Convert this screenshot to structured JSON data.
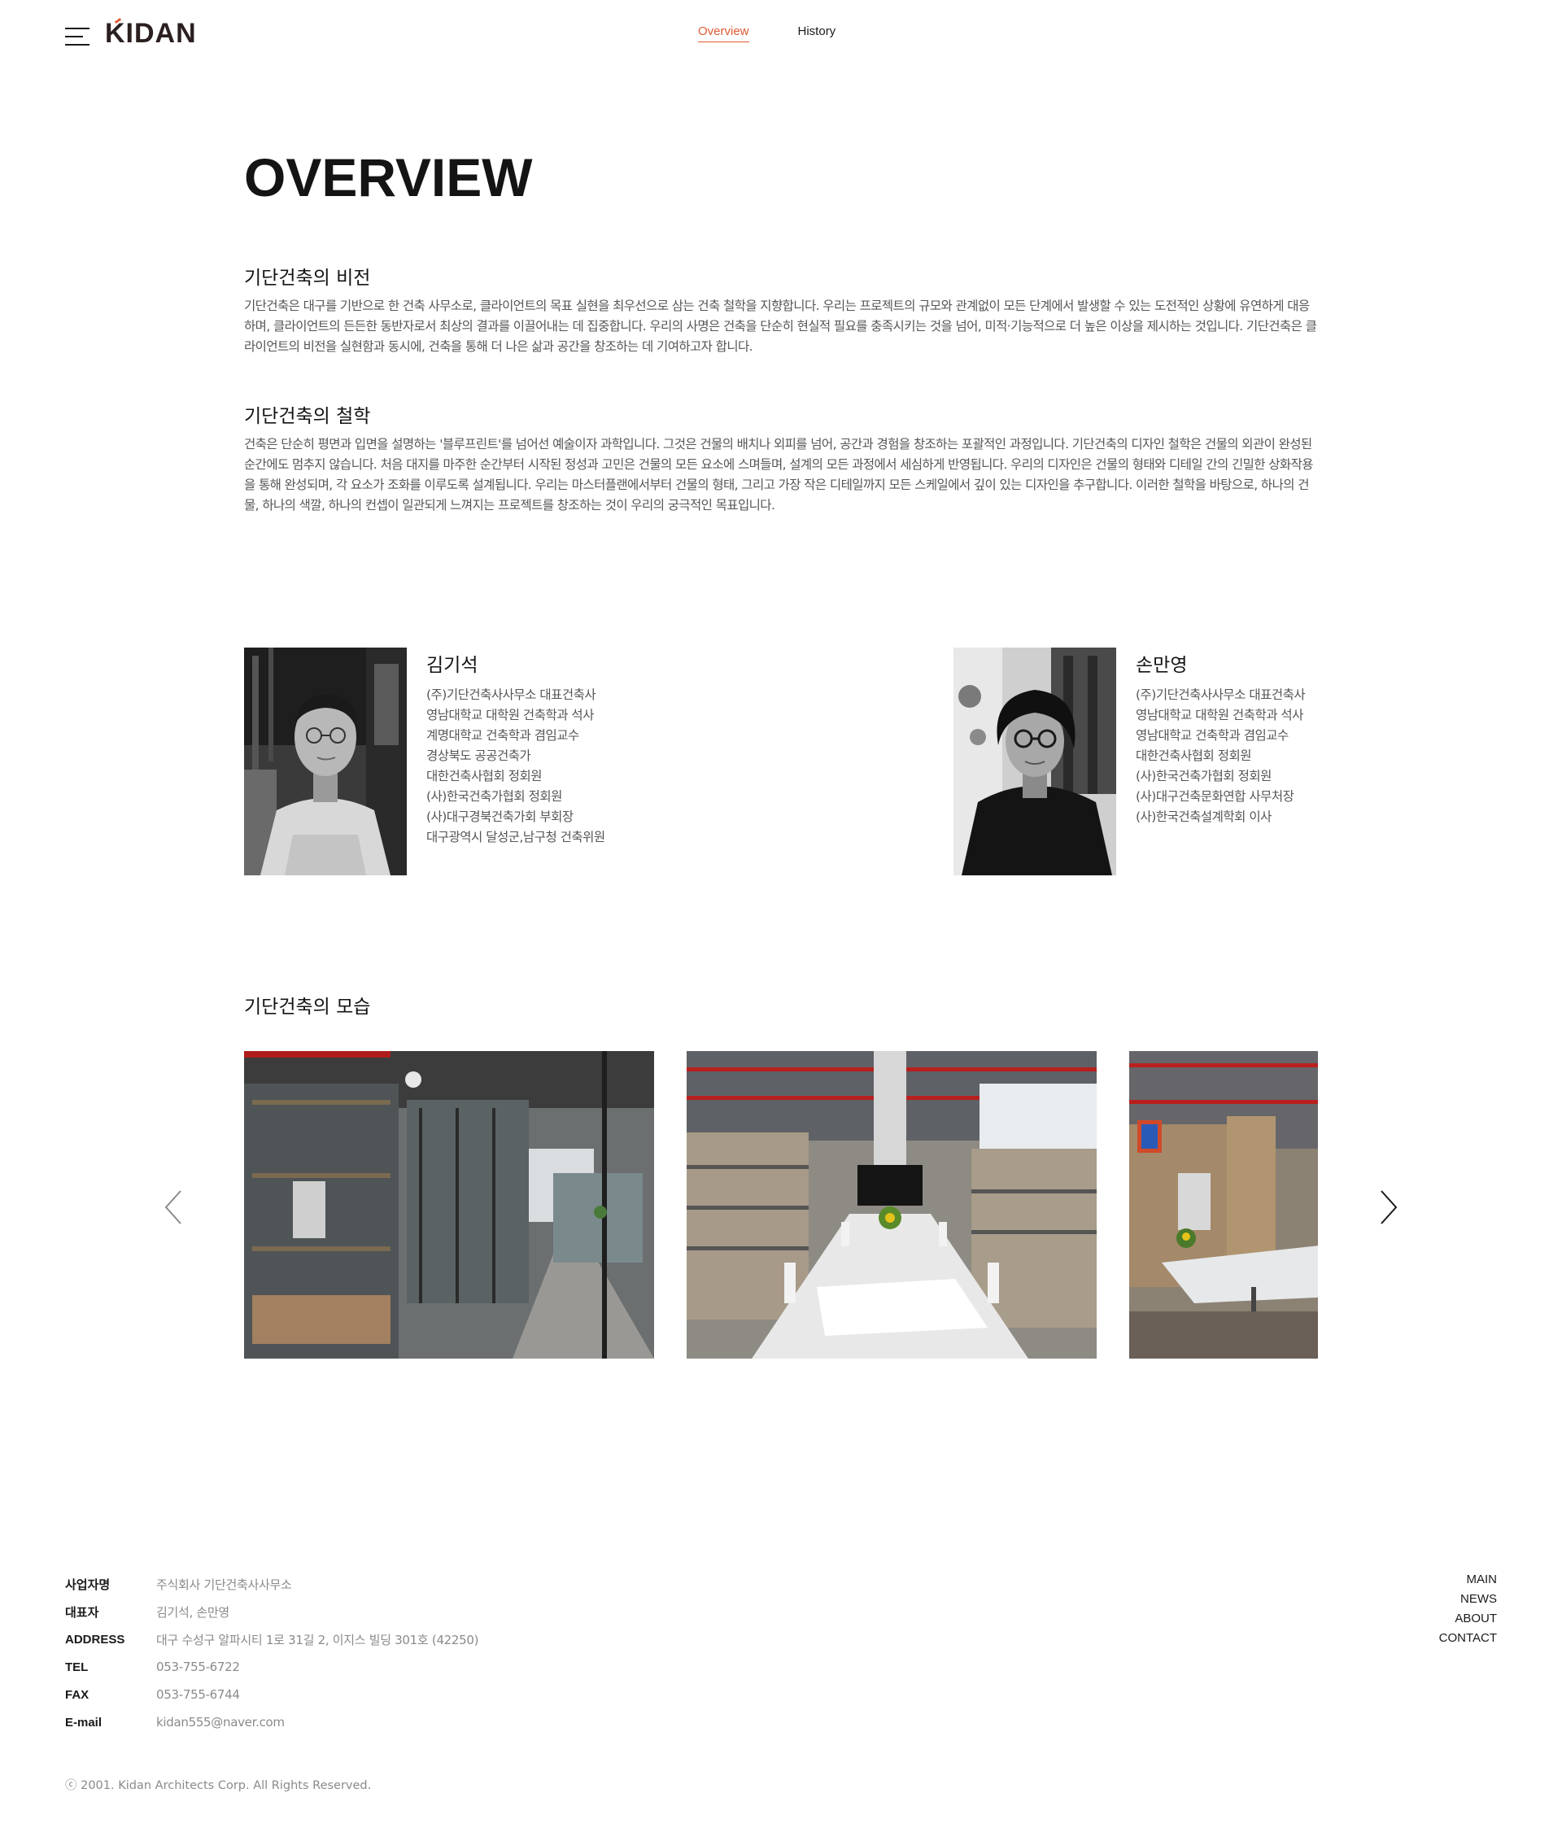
{
  "header": {
    "logo": "KIDAN",
    "nav": [
      {
        "label": "Overview",
        "active": true
      },
      {
        "label": "History",
        "active": false
      }
    ]
  },
  "overview": {
    "title": "OVERVIEW",
    "vision": {
      "heading": "기단건축의 비전",
      "body": "기단건축은 대구를 기반으로 한 건축 사무소로, 클라이언트의 목표 실현을 최우선으로 삼는 건축 철학을 지향합니다. 우리는 프로젝트의 규모와 관계없이 모든 단계에서 발생할 수 있는 도전적인 상황에 유연하게 대응하며, 클라이언트의 든든한 동반자로서 최상의 결과를 이끌어내는 데 집중합니다. 우리의 사명은 건축을 단순히 현실적 필요를 충족시키는 것을 넘어, 미적·기능적으로 더 높은 이상을 제시하는 것입니다. 기단건축은 클라이언트의 비전을 실현함과 동시에, 건축을 통해 더 나은 삶과 공간을 창조하는 데 기여하고자 합니다."
    },
    "philosophy": {
      "heading": "기단건축의 철학",
      "body": "건축은 단순히 평면과 입면을 설명하는 '블루프린트'를 넘어선 예술이자 과학입니다. 그것은 건물의 배치나 외피를 넘어, 공간과 경험을 창조하는 포괄적인 과정입니다. 기단건축의 디자인 철학은 건물의 외관이 완성된 순간에도 멈추지 않습니다. 처음 대지를 마주한 순간부터 시작된 정성과 고민은 건물의 모든 요소에 스며들며, 설계의 모든 과정에서 세심하게 반영됩니다. 우리의 디자인은 건물의 형태와 디테일 간의 긴밀한 상화작용을 통해 완성되며, 각 요소가 조화를 이루도록 설계됩니다. 우리는 마스터플랜에서부터 건물의 형태, 그리고 가장 작은 디테일까지 모든 스케일에서 깊이 있는 디자인을 추구합니다. 이러한 철학을 바탕으로, 하나의 건물, 하나의 색깔, 하나의 컨셉이 일관되게 느껴지는 프로젝트를 창조하는 것이 우리의 궁극적인 목표입니다."
    }
  },
  "people": [
    {
      "name": "김기석",
      "credentials": [
        "(주)기단건축사사무소 대표건축사",
        "영남대학교 대학원 건축학과 석사",
        "계명대학교 건축학과 겸임교수",
        "경상북도 공공건축가",
        "대한건축사협회 정회원",
        "(사)한국건축가협회 정회원",
        "(사)대구경북건축가회 부회장",
        "대구광역시 달성군,남구청 건축위원"
      ]
    },
    {
      "name": "손만영",
      "credentials": [
        "(주)기단건축사사무소 대표건축사",
        "영남대학교 대학원 건축학과 석사",
        "영남대학교 건축학과 겸임교수",
        "대한건축사협회 정회원",
        "(사)한국건축가협회 정회원",
        "(사)대구건축문화연합 사무처장",
        "(사)한국건축설계학회 이사"
      ]
    }
  ],
  "gallery": {
    "title": "기단건축의 모습"
  },
  "footer": {
    "info": [
      {
        "label": "사업자명",
        "value": "주식회사 기단건축사사무소"
      },
      {
        "label": "대표자",
        "value": "김기석, 손만영"
      },
      {
        "label": "ADDRESS",
        "value": "대구 수성구 알파시티 1로 31길 2, 이지스 빌딩 301호 (42250)"
      },
      {
        "label": "TEL",
        "value": "053-755-6722"
      },
      {
        "label": "FAX",
        "value": "053-755-6744"
      },
      {
        "label": "E-mail",
        "value": "kidan555@naver.com"
      }
    ],
    "nav": [
      "MAIN",
      "NEWS",
      "ABOUT",
      "CONTACT"
    ],
    "copyright": "ⓒ 2001. Kidan Architects Corp. All Rights Reserved."
  },
  "colors": {
    "accent": "#e05a34",
    "text": "#1a1a1a",
    "muted": "#555555",
    "footer_muted": "#8a8a8a"
  },
  "icons": {
    "menu": "hamburger-menu-icon",
    "prev": "chevron-left-icon",
    "next": "chevron-right-icon"
  }
}
